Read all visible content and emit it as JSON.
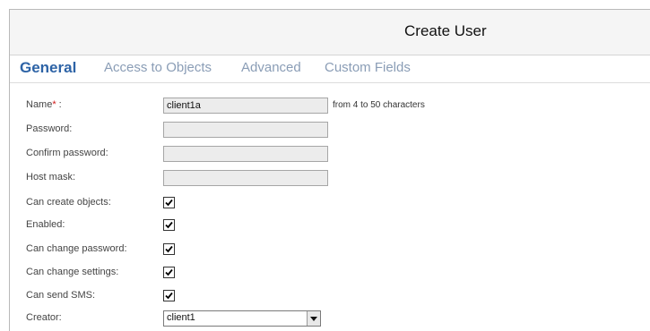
{
  "window": {
    "title": "Create User"
  },
  "tabs": [
    {
      "label": "General",
      "active": true
    },
    {
      "label": "Access to Objects",
      "active": false
    },
    {
      "label": "Advanced",
      "active": false
    },
    {
      "label": "Custom Fields",
      "active": false
    }
  ],
  "form": {
    "name": {
      "label": "Name",
      "required_mark": "*",
      "label_suffix": " :",
      "value": "client1a",
      "hint": "from 4 to 50 characters"
    },
    "password": {
      "label": "Password:",
      "value": ""
    },
    "confirm_password": {
      "label": "Confirm password:",
      "value": ""
    },
    "host_mask": {
      "label": "Host mask:",
      "value": ""
    },
    "can_create_objects": {
      "label": "Can create objects:",
      "checked": true
    },
    "enabled": {
      "label": "Enabled:",
      "checked": true
    },
    "can_change_password": {
      "label": "Can change password:",
      "checked": true
    },
    "can_change_settings": {
      "label": "Can change settings:",
      "checked": true
    },
    "can_send_sms": {
      "label": "Can send SMS:",
      "checked": true
    },
    "creator": {
      "label": "Creator:",
      "value": "client1"
    }
  },
  "colors": {
    "tab_active": "#2d63a6",
    "tab_inactive": "#8a9db6",
    "required": "#d01818"
  }
}
